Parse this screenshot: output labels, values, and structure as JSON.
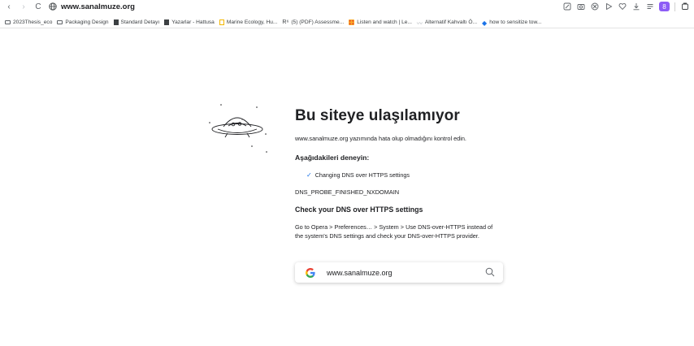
{
  "toolbar": {
    "back": "‹",
    "forward": "›",
    "reload": "C",
    "url_host": "www.sanalmuze.org",
    "profile_badge": "8"
  },
  "bookmarks": [
    {
      "label": "2023Thesis_eco",
      "icon": "folder-icon"
    },
    {
      "label": "Packaging Design",
      "icon": "folder-icon"
    },
    {
      "label": "Standard Detayı",
      "icon": "document-icon"
    },
    {
      "label": "Yazarlar - Hattusa",
      "icon": "document-icon"
    },
    {
      "label": "Marine Ecology, Hu...",
      "icon": "page-icon"
    },
    {
      "label": "(5) (PDF) Assessme...",
      "icon": "researchgate-icon"
    },
    {
      "label": "Listen and watch | Le...",
      "icon": "grid-icon"
    },
    {
      "label": "Alternatif Kahvaltı Ö...",
      "icon": "leaf-icon"
    },
    {
      "label": "how to sensitize tow...",
      "icon": "fish-icon"
    }
  ],
  "rg_glyph": "R⁶",
  "error": {
    "title": "Bu siteye ulaşılamıyor",
    "subtitle": "www.sanalmuze.org yazımında hata olup olmadığını kontrol edin.",
    "try_heading": "Aşağıdakileri deneyin:",
    "suggestion": "Changing DNS over HTTPS settings",
    "error_code": "DNS_PROBE_FINISHED_NXDOMAIN",
    "dns_heading": "Check your DNS over HTTPS settings",
    "dns_text": "Go to Opera > Preferences… > System > Use DNS-over-HTTPS instead of the system's DNS settings and check your DNS-over-HTTPS provider."
  },
  "search": {
    "engine_glyph": "G",
    "query": "www.sanalmuze.org"
  },
  "colors": {
    "accent": "#1a73e8",
    "profile": "#8d5cf6"
  }
}
